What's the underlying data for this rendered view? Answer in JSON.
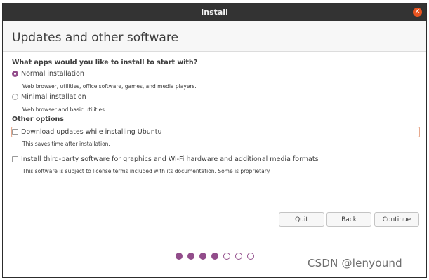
{
  "window": {
    "title": "Install",
    "close_glyph": "✕"
  },
  "header": {
    "title": "Updates and other software"
  },
  "install_section": {
    "question": "What apps would you like to install to start with?",
    "options": [
      {
        "label": "Normal installation",
        "description": "Web browser, utilities, office software, games, and media players.",
        "selected": true
      },
      {
        "label": "Minimal installation",
        "description": "Web browser and basic utilities.",
        "selected": false
      }
    ]
  },
  "other_options": {
    "heading": "Other options",
    "items": [
      {
        "label": "Download updates while installing Ubuntu",
        "description": "This saves time after installation.",
        "checked": false
      },
      {
        "label": "Install third-party software for graphics and Wi-Fi hardware and additional media formats",
        "description": "This software is subject to license terms included with its documentation. Some is proprietary.",
        "checked": false
      }
    ]
  },
  "buttons": {
    "quit": "Quit",
    "back": "Back",
    "continue": "Continue"
  },
  "progress": {
    "total_steps": 7,
    "completed_steps": 4
  },
  "watermark": "CSDN @lenyound",
  "colors": {
    "accent": "#924d8b",
    "close": "#e95420",
    "titlebar": "#333333"
  }
}
